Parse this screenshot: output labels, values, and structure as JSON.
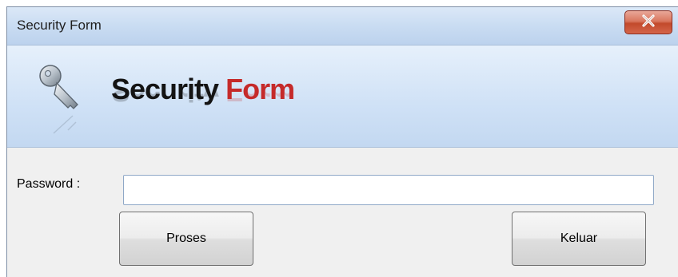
{
  "window": {
    "title": "Security Form",
    "close_icon": "close-icon"
  },
  "banner": {
    "icon": "key-icon",
    "title_word1": "Security",
    "title_word2": "Form",
    "title_word2_color": "#c52a2a"
  },
  "form": {
    "password_label": "Password :",
    "password_value": ""
  },
  "buttons": {
    "proses_label": "Proses",
    "keluar_label": "Keluar"
  }
}
